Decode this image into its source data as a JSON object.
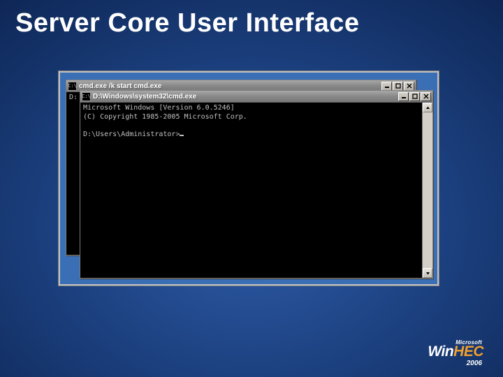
{
  "slide": {
    "title": "Server Core User Interface"
  },
  "windows": {
    "back": {
      "icon_glyph": "C:\\",
      "title": "cmd.exe /k start cmd.exe",
      "body_line1": "D:"
    },
    "front": {
      "icon_glyph": "C:\\",
      "title": "D:\\Windows\\system32\\cmd.exe",
      "body_line1": "Microsoft Windows [Version 6.0.5246]",
      "body_line2": "(C) Copyright 1985-2005 Microsoft Corp.",
      "body_line3": "",
      "body_prompt": "D:\\Users\\Administrator>"
    }
  },
  "branding": {
    "vendor": "Microsoft",
    "product_prefix": "Win",
    "product_accent": "HEC",
    "year": "2006"
  }
}
